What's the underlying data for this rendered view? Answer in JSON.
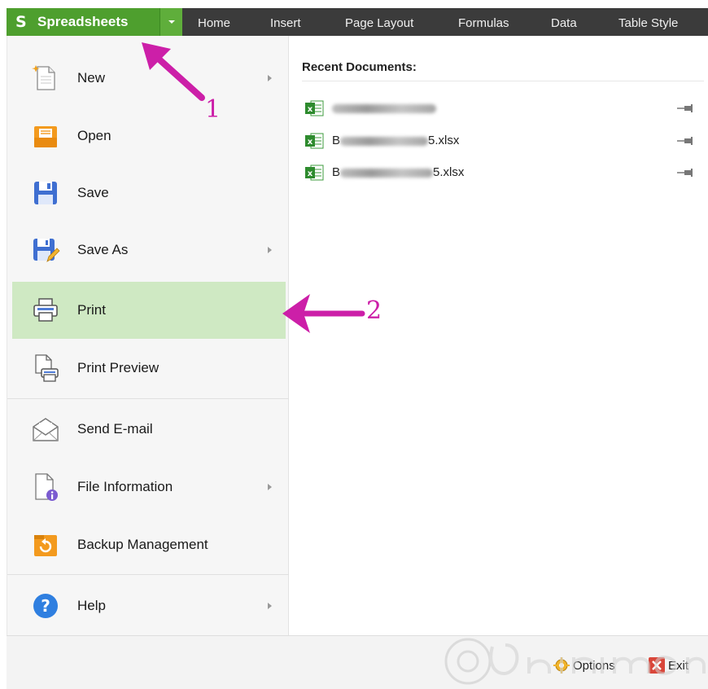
{
  "app": {
    "title": "Spreadsheets",
    "logo_glyph": "S",
    "accent_color": "#4e9f2e"
  },
  "ribbon": {
    "tabs": [
      "Home",
      "Insert",
      "Page Layout",
      "Formulas",
      "Data",
      "Table Style"
    ]
  },
  "menu": {
    "items": [
      {
        "label": "New",
        "icon": "new-file-icon",
        "has_submenu": true
      },
      {
        "label": "Open",
        "icon": "open-folder-icon",
        "has_submenu": false
      },
      {
        "label": "Save",
        "icon": "save-disk-icon",
        "has_submenu": false
      },
      {
        "label": "Save As",
        "icon": "save-as-icon",
        "has_submenu": true
      },
      {
        "label": "Print",
        "icon": "printer-icon",
        "has_submenu": false,
        "highlighted": true
      },
      {
        "label": "Print Preview",
        "icon": "print-preview-icon",
        "has_submenu": false
      },
      {
        "label": "Send E-mail",
        "icon": "envelope-icon",
        "has_submenu": false
      },
      {
        "label": "File Information",
        "icon": "file-info-icon",
        "has_submenu": true
      },
      {
        "label": "Backup Management",
        "icon": "backup-icon",
        "has_submenu": false
      },
      {
        "label": "Help",
        "icon": "help-icon",
        "has_submenu": true
      }
    ],
    "highlight_color": "#cfe9c3"
  },
  "recent": {
    "title": "Recent Documents:",
    "documents": [
      {
        "name_prefix": "",
        "name_suffix": "",
        "icon": "excel-file-icon"
      },
      {
        "name_prefix": "B",
        "name_suffix": "5.xlsx",
        "icon": "excel-file-icon"
      },
      {
        "name_prefix": "B",
        "name_suffix": "5.xlsx",
        "icon": "excel-file-icon"
      }
    ]
  },
  "footer": {
    "options_label": "Options",
    "exit_label": "Exit"
  },
  "annotations": {
    "arrow1_label": "1",
    "arrow2_label": "2",
    "color": "#cc1fa8"
  }
}
